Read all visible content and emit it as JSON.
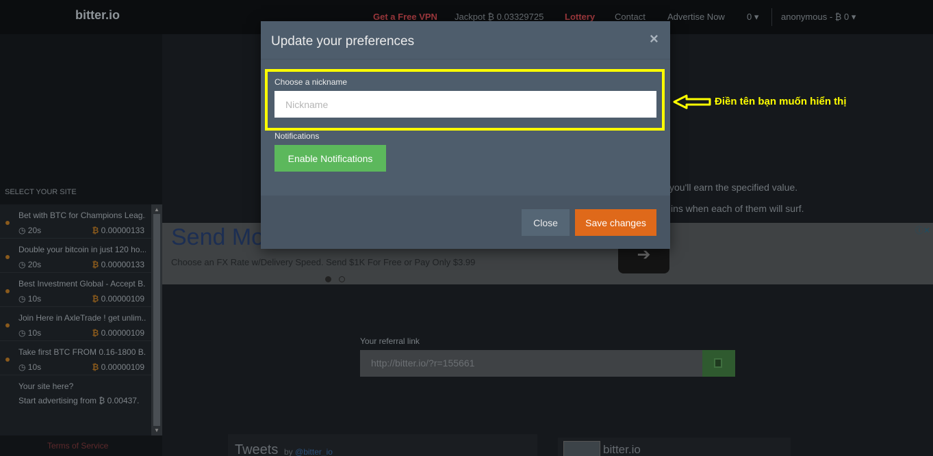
{
  "header": {
    "brand": "bitter.io",
    "nav": {
      "vpn": "Get a Free VPN",
      "jackpot": "Jackpot ₿ 0.03329725",
      "lottery": "Lottery",
      "contact": "Contact",
      "advertise": "Advertise Now",
      "count": "0 ▾",
      "user": "anonymous - ₿ 0 ▾"
    }
  },
  "sidebar": {
    "title": "SELECT YOUR SITE",
    "items": [
      {
        "title": "Bet with BTC for Champions Leag...",
        "time": "◷ 20s",
        "price": "0.00000133"
      },
      {
        "title": "Double your bitcoin in just 120 ho...",
        "time": "◷ 20s",
        "price": "0.00000133"
      },
      {
        "title": "Best Investment Global - Accept B...",
        "time": "◷ 10s",
        "price": "0.00000109"
      },
      {
        "title": "Join Here in AxleTrade ! get unlim...",
        "time": "◷ 10s",
        "price": "0.00000109"
      },
      {
        "title": "Take first BTC FROM 0.16-1800 B...",
        "time": "◷ 10s",
        "price": "0.00000109"
      }
    ],
    "promo": {
      "title": "Your site here?",
      "sub": "Start advertising from ₿ 0.00437."
    },
    "btc_symbol": "₿",
    "terms": "Terms of Service"
  },
  "main": {
    "earn_line1": "you'll earn the specified value.",
    "earn_line2": "ins when each of them will surf.",
    "ad": {
      "title": "Send Mo",
      "text": "Choose an FX Rate w/Delivery Speed. Send $1K For Free or Pay Only $3.99",
      "arrow": "➔",
      "info": "ⓘ✕"
    },
    "referral": {
      "label": "Your referral link",
      "value": "http://bitter.io/?r=155661"
    },
    "tweets": {
      "title": "Tweets",
      "by": "by",
      "handle": "@bitter_io"
    },
    "fb": {
      "name": "bitter.io"
    }
  },
  "modal": {
    "title": "Update your preferences",
    "close_x": "×",
    "nickname_label": "Choose a nickname",
    "nickname_placeholder": "Nickname",
    "nickname_value": "",
    "notifications_label": "Notifications",
    "enable_button": "Enable Notifications",
    "close_button": "Close",
    "save_button": "Save changes"
  },
  "annotation": {
    "text": "Điền tên bạn muốn hiển thị",
    "color": "#ffff00"
  },
  "colors": {
    "accent_orange": "#df691a",
    "success_green": "#5cb85c",
    "modal_bg": "#4e5d6c"
  }
}
